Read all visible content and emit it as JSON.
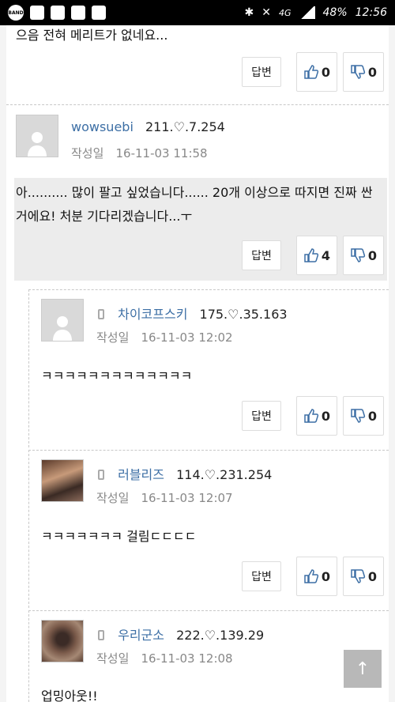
{
  "status_bar": {
    "battery": "48%",
    "time": "12:56",
    "network": "4G",
    "band_badge": "BAND"
  },
  "top_comment": {
    "text": "으음 전혀 메리트가 없네요...",
    "reply_label": "답변",
    "likes": "0",
    "dislikes": "0"
  },
  "comments": [
    {
      "author": "wowsuebi",
      "ip": "211.♡.7.254",
      "date_label": "작성일",
      "date": "16-11-03 11:58",
      "text": "아.......... 많이 팔고 싶었습니다...... 20개 이상으로 따지면 진짜 싼거에요! 처분 기다리겠습니다...ㅜ",
      "reply_label": "답변",
      "likes": "4",
      "dislikes": "0"
    },
    {
      "author": "차이코프스키",
      "ip": "175.♡.35.163",
      "date_label": "작성일",
      "date": "16-11-03 12:02",
      "text": "ㅋㅋㅋㅋㅋㅋㅋㅋㅋㅋㅋㅋㅋ",
      "reply_label": "답변",
      "likes": "0",
      "dislikes": "0"
    },
    {
      "author": "러블리즈",
      "ip": "114.♡.231.254",
      "date_label": "작성일",
      "date": "16-11-03 12:07",
      "text": "ㅋㅋㅋㅋㅋㅋㅋ 걸림ㄷㄷㄷㄷ",
      "reply_label": "답변",
      "likes": "0",
      "dislikes": "0"
    },
    {
      "author": "우리군소",
      "ip": "222.♡.139.29",
      "date_label": "작성일",
      "date": "16-11-03 12:08",
      "text": "업밍아웃!!"
    }
  ],
  "scroll_top_icon": "arrow-up-icon"
}
